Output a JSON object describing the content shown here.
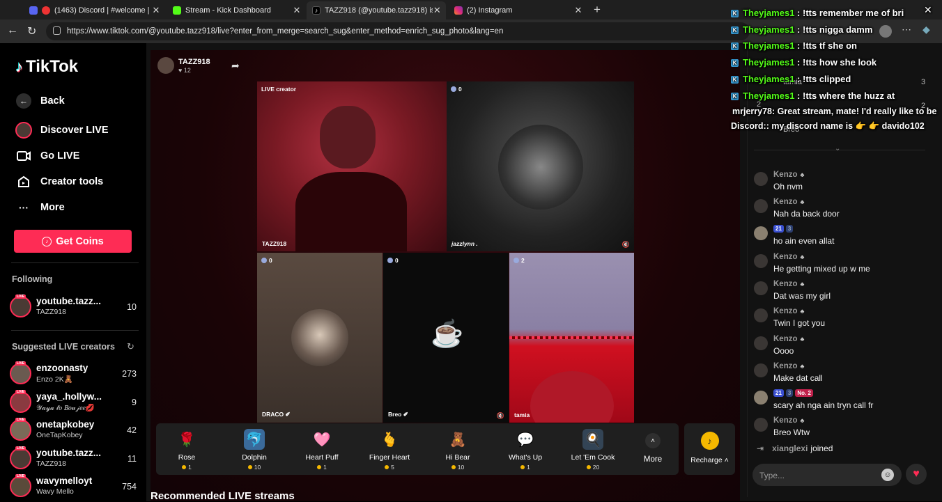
{
  "browser": {
    "tabs": [
      {
        "title": "(1463) Discord | #welcome |",
        "color": "#5865f2"
      },
      {
        "title": "Stream - Kick Dashboard",
        "color": "#53fc18"
      },
      {
        "title": "TAZZ918 (@youtube.tazz918) is LIVE",
        "color": "#000000"
      },
      {
        "title": "(2) Instagram",
        "color": "#e1306c"
      }
    ],
    "url": "https://www.tiktok.com/@youtube.tazz918/live?enter_from_merge=search_sug&enter_method=enrich_sug_photo&lang=en"
  },
  "sidebar": {
    "logo": "TikTok",
    "back": "Back",
    "nav": [
      "Discover LIVE",
      "Go LIVE",
      "Creator tools",
      "More"
    ],
    "get_coins": "Get Coins",
    "following_heading": "Following",
    "following": [
      {
        "name": "youtube.tazz...",
        "sub": "TAZZ918",
        "count": "10"
      }
    ],
    "suggested_heading": "Suggested LIVE creators",
    "suggested": [
      {
        "name": "enzoonasty",
        "sub": "Enzo 2K🧸",
        "count": "273"
      },
      {
        "name": "yaya_.hollyw...",
        "sub": "𝒴𝒶𝓎𝒶 𝓉𝑜 𝐵𝑜𝓊𝒿𝑒𝑒💋",
        "count": "9"
      },
      {
        "name": "onetapkobey",
        "sub": "OneTapKobey",
        "count": "42"
      },
      {
        "name": "youtube.tazz...",
        "sub": "TAZZ918",
        "count": "11"
      },
      {
        "name": "wavymelloyt",
        "sub": "Wavy Mello",
        "count": "754"
      }
    ],
    "live_badge": "LIVE"
  },
  "stream": {
    "host_name": "TAZZ918",
    "host_likes": "♥ 12",
    "tiles": [
      {
        "tag": "LIVE creator",
        "label": "TAZZ918",
        "viewers": ""
      },
      {
        "tag": "",
        "label": "jazzlynn .",
        "viewers": "0"
      },
      {
        "tag": "",
        "label": "DRACO ✐",
        "viewers": "0"
      },
      {
        "tag": "",
        "label": "Breo ✐",
        "viewers": "0"
      },
      {
        "tag": "",
        "label": "tamia",
        "viewers": "2"
      }
    ]
  },
  "gifts": [
    {
      "name": "Rose",
      "price": "1",
      "icon": "🌹"
    },
    {
      "name": "Dolphin",
      "price": "10",
      "icon": "🐬"
    },
    {
      "name": "Heart Puff",
      "price": "1",
      "icon": "🩷"
    },
    {
      "name": "Finger Heart",
      "price": "5",
      "icon": "🫰"
    },
    {
      "name": "Hi Bear",
      "price": "10",
      "icon": "🧸"
    },
    {
      "name": "What's Up",
      "price": "1",
      "icon": "💬"
    },
    {
      "name": "Let 'Em Cook",
      "price": "20",
      "icon": "🍳"
    }
  ],
  "gift_more": "More",
  "recharge": "Recharge",
  "recommended": "Recommended LIVE streams",
  "chat": {
    "ranking": [
      {
        "pos": "2",
        "name": "tamia",
        "score": "3"
      },
      {
        "pos": "",
        "name": "Breo",
        "score": "2"
      }
    ],
    "messages": [
      {
        "name": "Kenzo",
        "badges": [],
        "text": "Oh nvm"
      },
      {
        "name": "Kenzo",
        "badges": [],
        "text": "Nah da back door"
      },
      {
        "name": "",
        "badges": [
          "21",
          "3"
        ],
        "text": "ho ain even allat"
      },
      {
        "name": "Kenzo",
        "badges": [],
        "text": "He getting mixed up w me"
      },
      {
        "name": "Kenzo",
        "badges": [],
        "text": "Dat was my girl"
      },
      {
        "name": "Kenzo",
        "badges": [],
        "text": "Twin I got you"
      },
      {
        "name": "Kenzo",
        "badges": [],
        "text": "Oooo"
      },
      {
        "name": "Kenzo",
        "badges": [],
        "text": "Make dat call"
      },
      {
        "name": "",
        "badges": [
          "21",
          "3",
          "No. 2"
        ],
        "text": "scary ah nga ain tryn call fr"
      },
      {
        "name": "Kenzo",
        "badges": [],
        "text": "Breo Wtw"
      }
    ],
    "joined_user": "xianglexi",
    "joined_text": "joined",
    "placeholder": "Type..."
  },
  "overlay": {
    "lines": [
      {
        "user": "Theyjames1",
        "text": " : !tts remember me of bri"
      },
      {
        "user": "Theyjames1",
        "text": " : !tts nigga damm"
      },
      {
        "user": "Theyjames1",
        "text": " : !tts tf she on"
      },
      {
        "user": "Theyjames1",
        "text": " : !tts how she look"
      },
      {
        "user": "Theyjames1",
        "text": " : !tts clipped"
      },
      {
        "user": "Theyjames1",
        "text": " : !tts where the huzz at"
      }
    ],
    "extra1_user": "mrjerry78",
    "extra1_text": ": Great stream, mate! I'd really like to be",
    "extra2": "Discord:: my discord name is 👉 👉 davido102"
  }
}
